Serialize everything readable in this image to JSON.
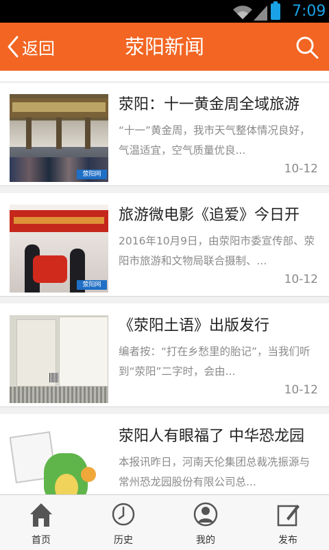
{
  "status_bar": {
    "time": "7:09"
  },
  "header": {
    "back_label": "返回",
    "title": "荥阳新闻"
  },
  "news": [
    {
      "title": "荥阳：十一黄金周全域旅游",
      "summary": "“十一”黄金周，我市天气整体情况良好，气温适宜，空气质量优良...",
      "date": "10-12",
      "watermark": "荥阳网"
    },
    {
      "title": "旅游微电影《追爱》今日开",
      "summary": "2016年10月9日，由荥阳市委宣传部、荥阳市旅游和文物局联合摄制、...",
      "date": "10-12",
      "watermark": "荥阳网"
    },
    {
      "title": "《荥阳土语》出版发行",
      "summary": "编者按：“打在乡愁里的胎记”，当我们听到“荥阳”二字时，会由...",
      "date": "10-12"
    },
    {
      "title": "荥阳人有眼福了 中华恐龙园",
      "summary": "本报讯昨日，河南天伦集团总裁冼振源与常州恐龙园股份有限公司总...",
      "date": ""
    }
  ],
  "bottom_nav": [
    {
      "label": "首页",
      "icon": "home-icon"
    },
    {
      "label": "历史",
      "icon": "clock-icon"
    },
    {
      "label": "我的",
      "icon": "user-icon"
    },
    {
      "label": "发布",
      "icon": "edit-icon"
    }
  ],
  "colors": {
    "accent": "#f26522",
    "status_icon": "#19a2e6"
  }
}
